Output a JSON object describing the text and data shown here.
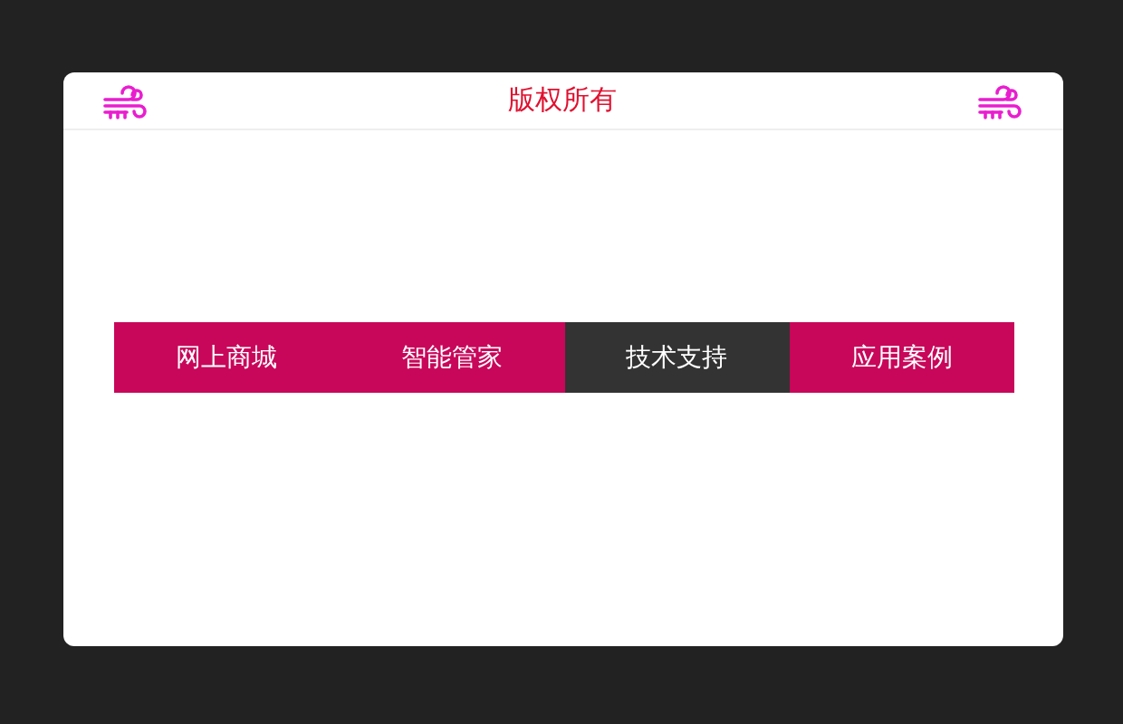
{
  "header": {
    "title": "版权所有"
  },
  "menu": [
    {
      "label": "网上商城",
      "selected": false
    },
    {
      "label": "智能管家",
      "selected": false
    },
    {
      "label": "技术支持",
      "selected": true
    },
    {
      "label": "应用案例",
      "selected": false
    }
  ]
}
